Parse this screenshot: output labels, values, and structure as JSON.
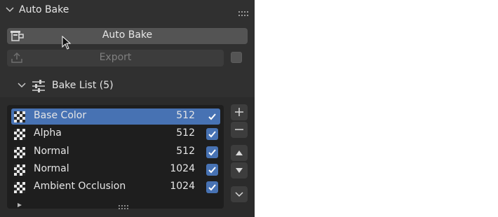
{
  "panel": {
    "title": "Auto Bake"
  },
  "actions": {
    "auto_bake_label": "Auto Bake",
    "export_label": "Export",
    "export_checked": false
  },
  "bake_list": {
    "title": "Bake List (5)",
    "items": [
      {
        "name": "Base Color",
        "resolution": "512",
        "enabled": true,
        "selected": true
      },
      {
        "name": "Alpha",
        "resolution": "512",
        "enabled": true,
        "selected": false
      },
      {
        "name": "Normal",
        "resolution": "512",
        "enabled": true,
        "selected": false
      },
      {
        "name": "Normal",
        "resolution": "1024",
        "enabled": true,
        "selected": false
      },
      {
        "name": "Ambient Occlusion",
        "resolution": "1024",
        "enabled": true,
        "selected": false
      }
    ]
  },
  "icons": {
    "collapse": "chevron-down-icon",
    "drag": "drag-handle-icon",
    "bake": "bake-icon",
    "export": "export-icon",
    "list": "sliders-icon",
    "item": "checker-texture-icon",
    "add": "plus-icon",
    "remove": "minus-icon",
    "move_up": "triangle-up-icon",
    "move_down": "triangle-down-icon",
    "more": "chevron-down-icon",
    "filter": "triangle-right-icon",
    "resize": "resize-grip-icon"
  },
  "colors": {
    "panel_bg": "#303030",
    "accent": "#4772b3",
    "button_bg": "#545454",
    "list_bg": "#1e1e1e"
  }
}
